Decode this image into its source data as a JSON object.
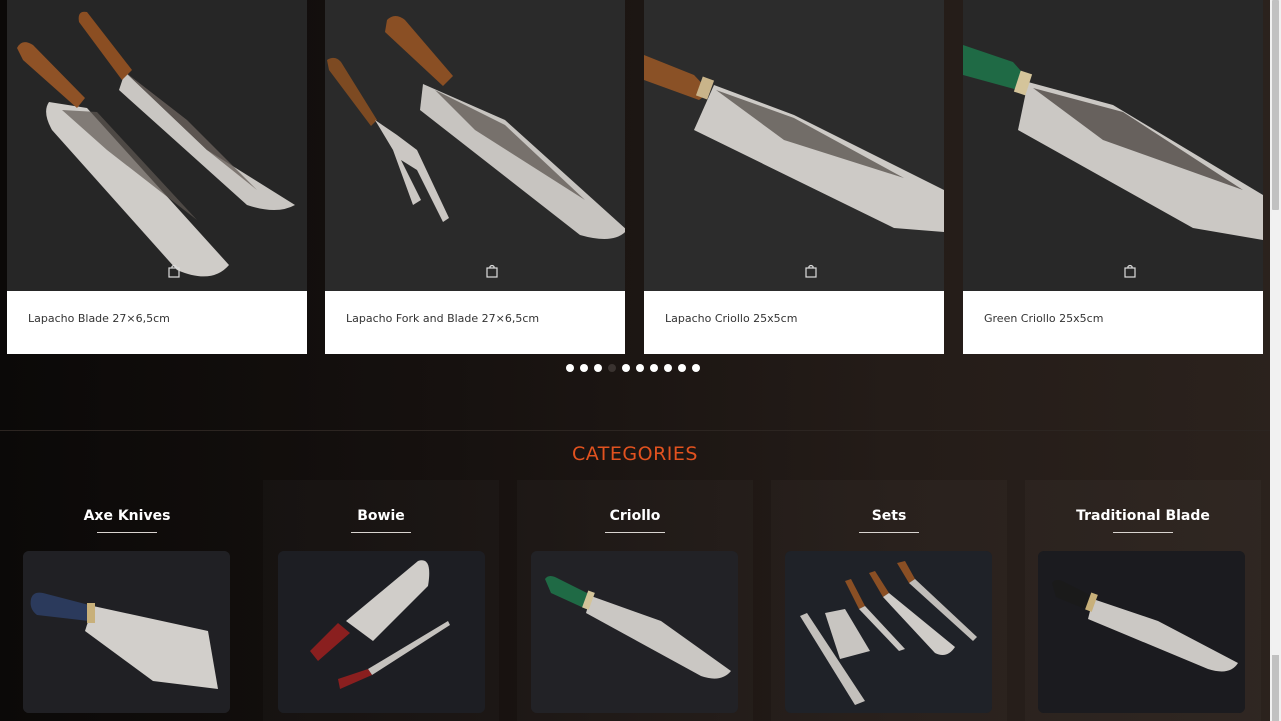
{
  "products": [
    {
      "name": "Lapacho Blade 27×6,5cm",
      "icon": "shopping-bag-icon"
    },
    {
      "name": "Lapacho Fork and Blade 27×6,5cm",
      "icon": "shopping-bag-icon"
    },
    {
      "name": "Lapacho Criollo 25x5cm",
      "icon": "shopping-bag-icon"
    },
    {
      "name": "Green Criollo 25x5cm",
      "icon": "shopping-bag-icon"
    }
  ],
  "carousel": {
    "dot_count": 10,
    "active_dot": 3
  },
  "categories_section": {
    "title": "CATEGORIES",
    "items": [
      {
        "label": "Axe Knives"
      },
      {
        "label": "Bowie"
      },
      {
        "label": "Criollo"
      },
      {
        "label": "Sets"
      },
      {
        "label": "Traditional Blade"
      }
    ]
  },
  "colors": {
    "accent": "#e2521f",
    "background": "#16110f",
    "card": "#ffffff"
  }
}
